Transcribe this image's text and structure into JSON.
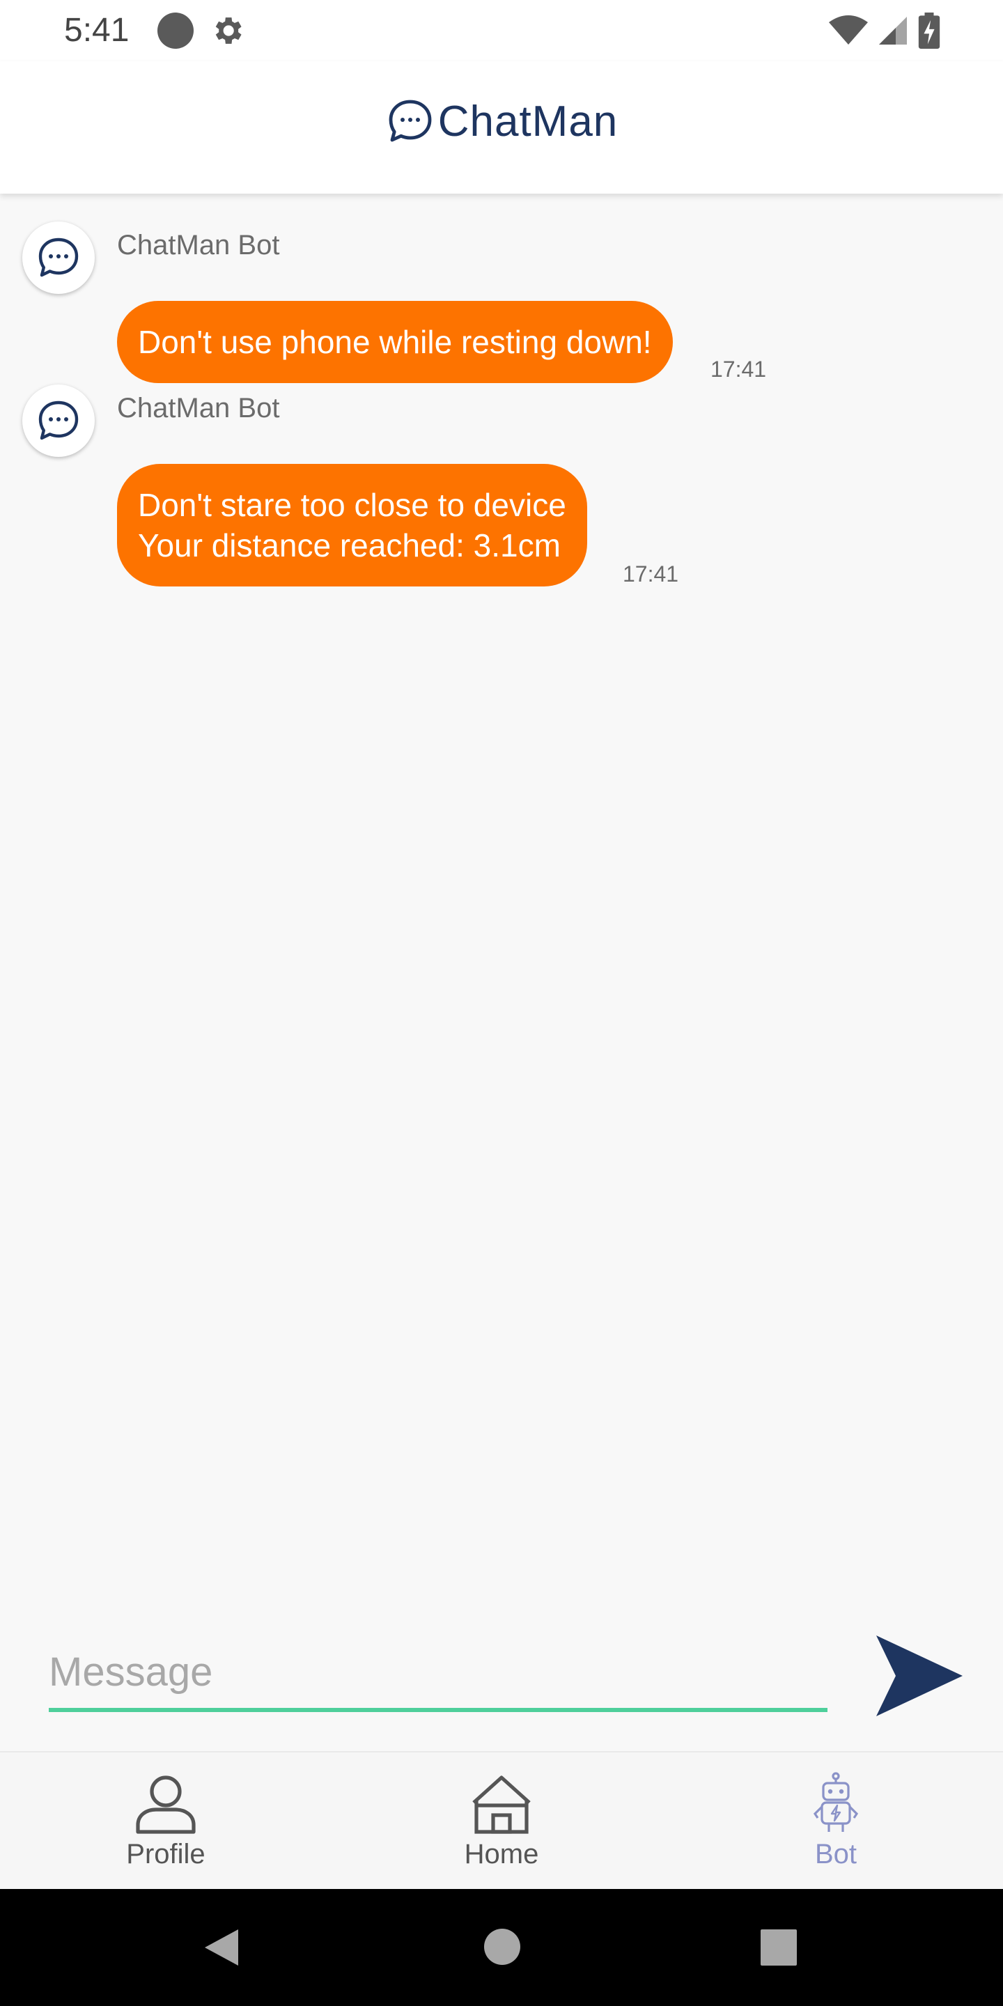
{
  "status_bar": {
    "time": "5:41",
    "icons": [
      "circle-indicator-icon",
      "gear-icon",
      "wifi-icon",
      "signal-icon",
      "battery-charging-icon"
    ]
  },
  "header": {
    "title": "ChatMan",
    "logo_icon": "chat-bubble-icon",
    "title_color": "#1e3560"
  },
  "messages": [
    {
      "sender": "ChatMan Bot",
      "text": "Don't use phone while resting down!",
      "time": "17:41"
    },
    {
      "sender": "ChatMan Bot",
      "text": "Don't stare too close to device\nYour distance reached: 3.1cm",
      "time": "17:41"
    }
  ],
  "composer": {
    "placeholder": "Message",
    "value": "",
    "send_icon": "send-arrow-icon",
    "underline_color": "#4ecf9b"
  },
  "bottom_nav": {
    "items": [
      {
        "label": "Profile",
        "icon": "person-icon",
        "active": false
      },
      {
        "label": "Home",
        "icon": "home-icon",
        "active": false
      },
      {
        "label": "Bot",
        "icon": "robot-icon",
        "active": true
      }
    ],
    "active_color": "#8a92c8",
    "inactive_color": "#555555"
  },
  "system_nav": {
    "icons": [
      "back-icon",
      "home-circle-icon",
      "recents-icon"
    ]
  },
  "colors": {
    "bubble": "#fd7300",
    "background": "#f8f8f8",
    "brand_navy": "#1e3560"
  }
}
